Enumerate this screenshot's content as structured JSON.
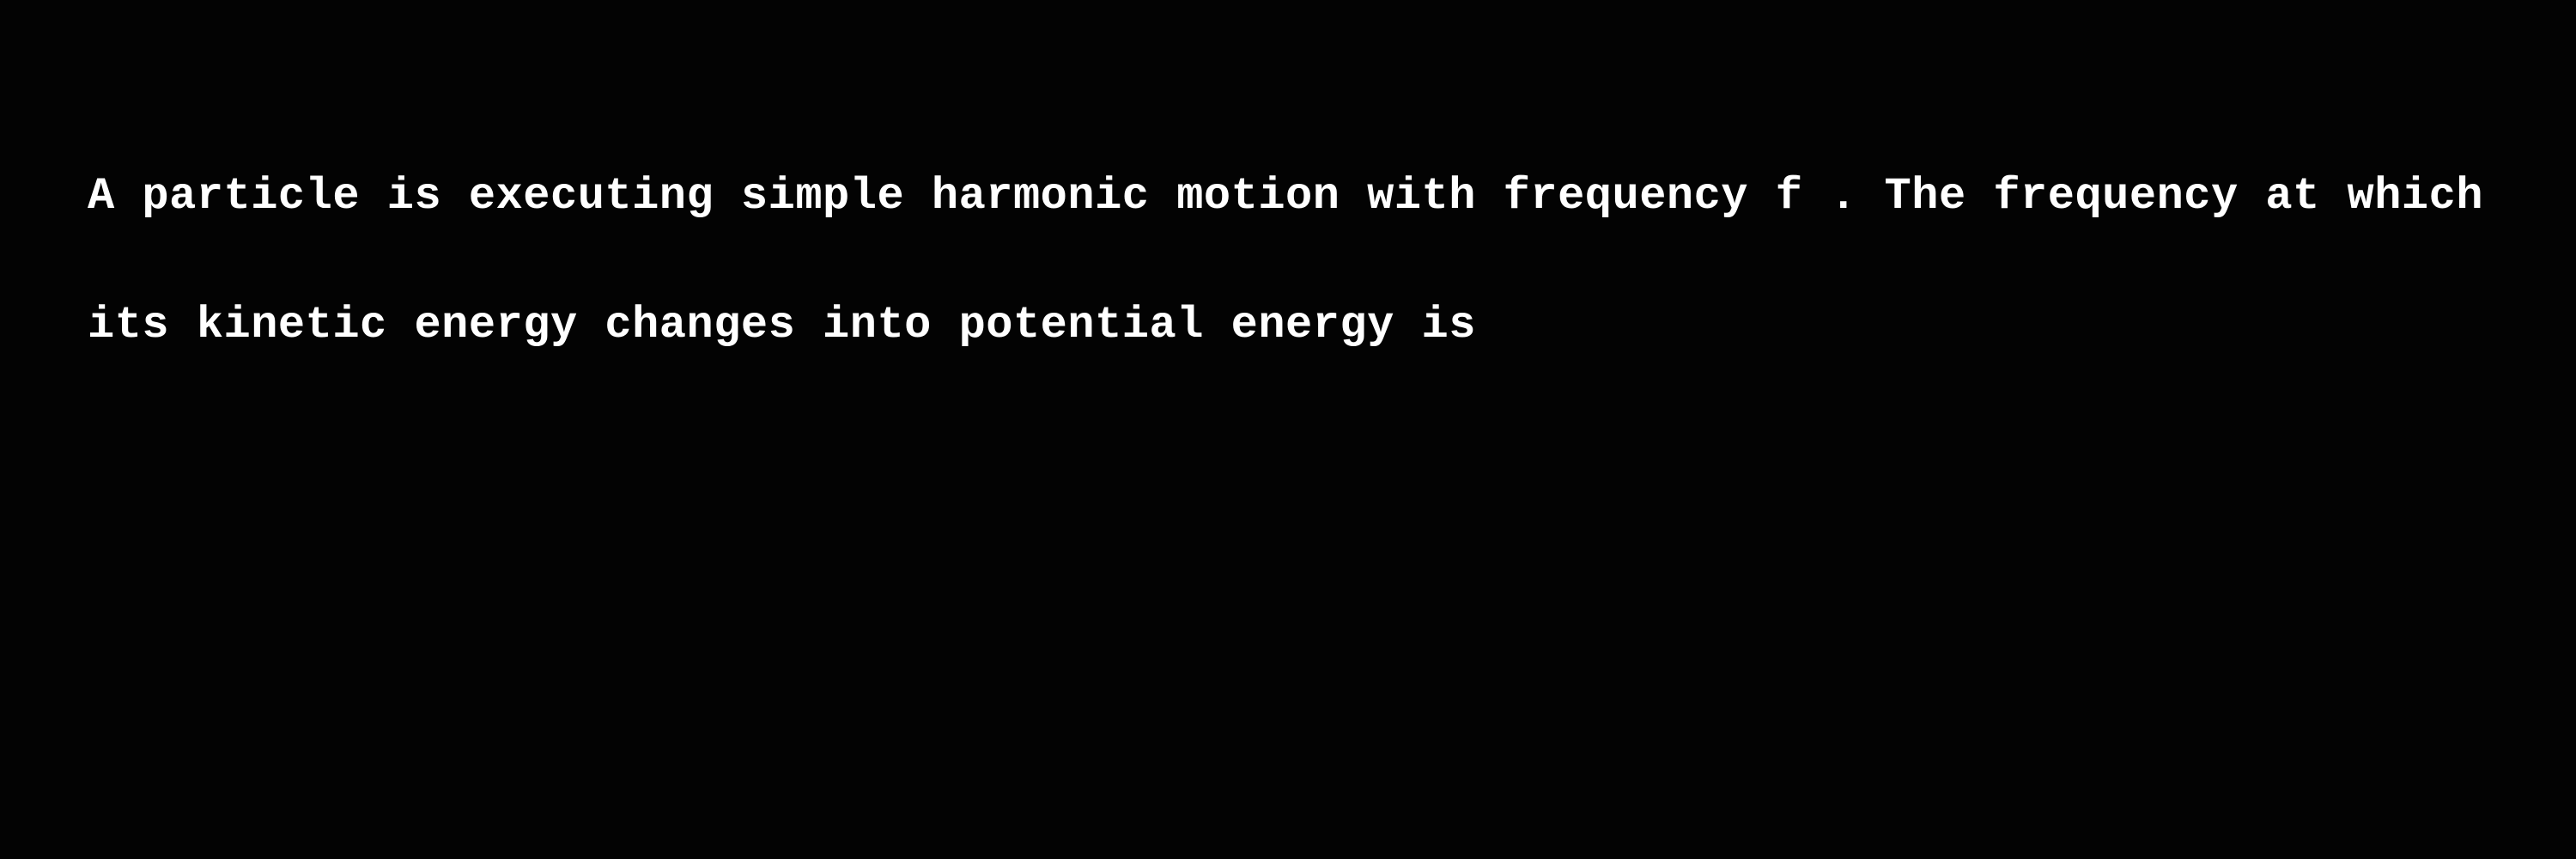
{
  "colors": {
    "background": "#030303",
    "text": "#ffffff"
  },
  "question": {
    "line_1": "A particle is executing simple harmonic motion with frequency f . The frequency at which",
    "line_2": "its kinetic energy changes into potential energy is"
  }
}
